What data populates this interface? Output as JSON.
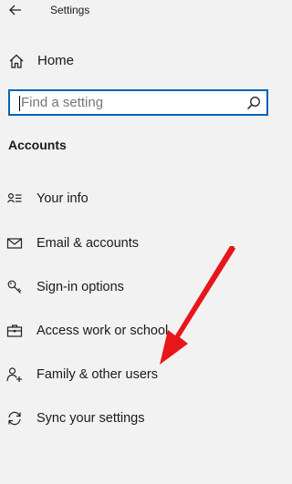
{
  "window": {
    "title": "Settings"
  },
  "home": {
    "label": "Home"
  },
  "search": {
    "placeholder": "Find a setting"
  },
  "section": {
    "title": "Accounts"
  },
  "nav": {
    "items": [
      {
        "label": "Your info",
        "icon": "person-card-icon"
      },
      {
        "label": "Email & accounts",
        "icon": "mail-icon"
      },
      {
        "label": "Sign-in options",
        "icon": "key-icon"
      },
      {
        "label": "Access work or school",
        "icon": "briefcase-icon"
      },
      {
        "label": "Family & other users",
        "icon": "add-person-icon"
      },
      {
        "label": "Sync your settings",
        "icon": "sync-icon"
      }
    ]
  },
  "annotation": {
    "arrow_color": "#e8161b"
  }
}
